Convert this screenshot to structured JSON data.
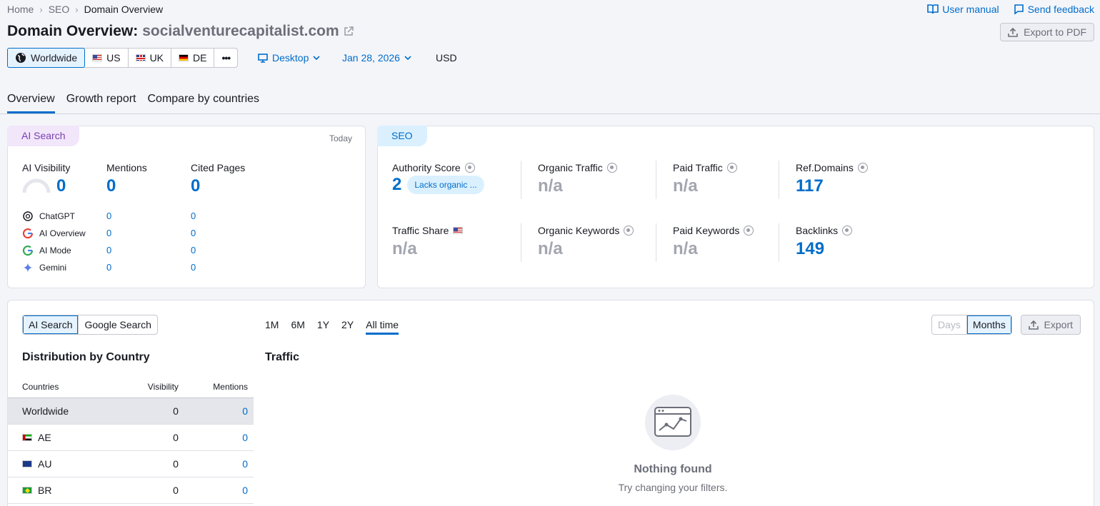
{
  "breadcrumb": [
    "Home",
    "SEO",
    "Domain Overview"
  ],
  "toplinks": {
    "manual": "User manual",
    "feedback": "Send feedback"
  },
  "title": {
    "prefix": "Domain Overview:",
    "domain": "socialventurecapitalist.com"
  },
  "export_pdf": "Export to PDF",
  "databases": [
    "Worldwide",
    "US",
    "UK",
    "DE"
  ],
  "more": "•••",
  "device": "Desktop",
  "date": "Jan 28, 2026",
  "currency": "USD",
  "tabs": [
    "Overview",
    "Growth report",
    "Compare by countries"
  ],
  "ai_card": {
    "badge": "AI Search",
    "today": "Today",
    "labels": {
      "visibility": "AI Visibility",
      "mentions": "Mentions",
      "cited": "Cited Pages"
    },
    "values": {
      "visibility": "0",
      "mentions": "0",
      "cited": "0"
    },
    "rows": [
      {
        "name": "ChatGPT",
        "mentions": "0",
        "cited": "0"
      },
      {
        "name": "AI Overview",
        "mentions": "0",
        "cited": "0"
      },
      {
        "name": "AI Mode",
        "mentions": "0",
        "cited": "0"
      },
      {
        "name": "Gemini",
        "mentions": "0",
        "cited": "0"
      }
    ]
  },
  "seo_card": {
    "badge": "SEO",
    "authority": {
      "label": "Authority Score",
      "value": "2",
      "tag": "Lacks organic ..."
    },
    "organic_traffic": {
      "label": "Organic Traffic",
      "value": "n/a"
    },
    "paid_traffic": {
      "label": "Paid Traffic",
      "value": "n/a"
    },
    "ref_domains": {
      "label": "Ref.Domains",
      "value": "117"
    },
    "traffic_share": {
      "label": "Traffic Share",
      "value": "n/a"
    },
    "organic_keywords": {
      "label": "Organic Keywords",
      "value": "n/a"
    },
    "paid_keywords": {
      "label": "Paid Keywords",
      "value": "n/a"
    },
    "backlinks": {
      "label": "Backlinks",
      "value": "149"
    }
  },
  "bottom": {
    "source_toggle": [
      "AI Search",
      "Google Search"
    ],
    "periods": [
      "1M",
      "6M",
      "1Y",
      "2Y",
      "All time"
    ],
    "granularity": [
      "Days",
      "Months"
    ],
    "export": "Export",
    "dist_title": "Distribution by Country",
    "traffic_title": "Traffic",
    "table_headers": [
      "Countries",
      "Visibility",
      "Mentions"
    ],
    "table_rows": [
      {
        "country": "Worldwide",
        "visibility": "0",
        "mentions": "0"
      },
      {
        "country": "AE",
        "visibility": "0",
        "mentions": "0"
      },
      {
        "country": "AU",
        "visibility": "0",
        "mentions": "0"
      },
      {
        "country": "BR",
        "visibility": "0",
        "mentions": "0"
      }
    ],
    "empty_title": "Nothing found",
    "empty_sub": "Try changing your filters."
  }
}
